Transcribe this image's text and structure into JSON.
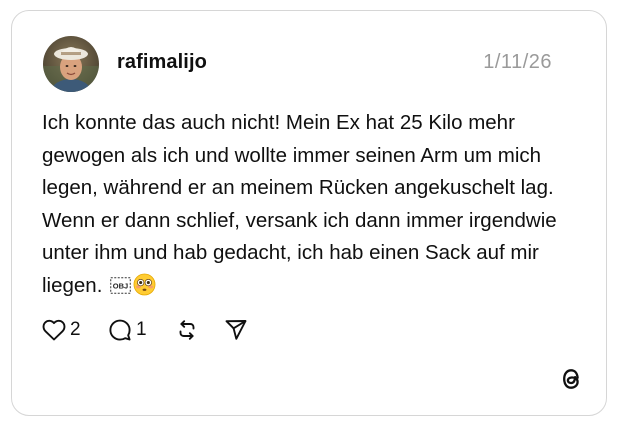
{
  "post": {
    "username": "rafimalijo",
    "date": "1/11/26",
    "text_before_glyph": "Ich konnte das auch nicht! Mein Ex hat 25 Kilo mehr gewogen als ich und wollte immer seinen Arm um mich legen, während er an meinem Rücken angekuschelt lag. Wenn er dann schlief, versank ich dann immer irgendwie unter ihm und hab gedacht, ich hab einen Sack auf mir liegen. ",
    "object_glyph": "OBJ",
    "emoji": "flushed-face"
  },
  "actions": {
    "likes": "2",
    "replies": "1",
    "like_icon": "heart-icon",
    "reply_icon": "comment-bubble-icon",
    "repost_icon": "repost-icon",
    "share_icon": "send-icon"
  },
  "branding": {
    "logo": "threads-logo"
  }
}
